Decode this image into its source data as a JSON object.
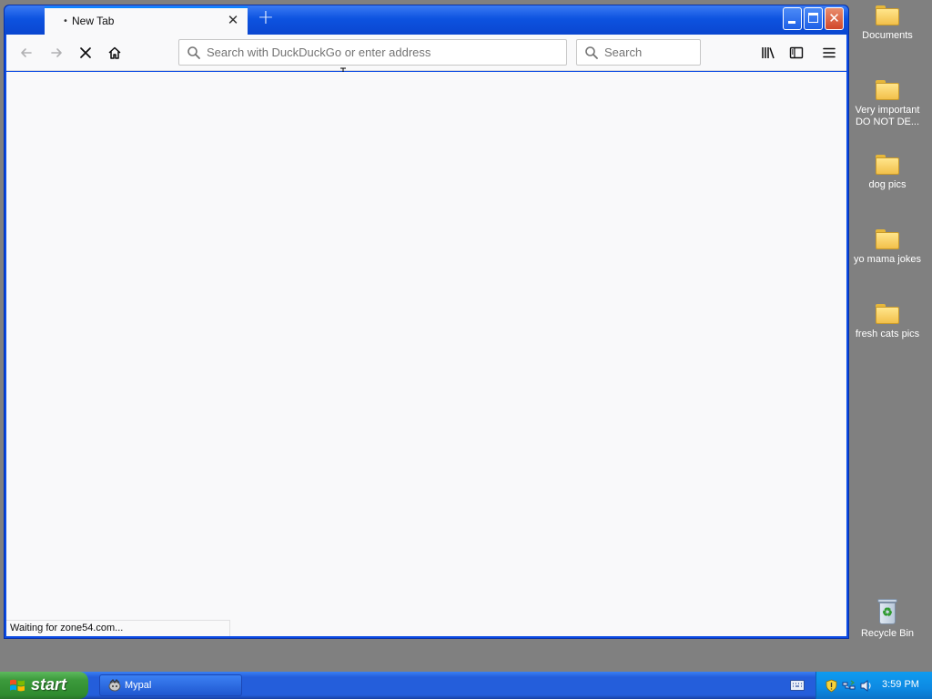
{
  "browser": {
    "tab": {
      "title": "New Tab",
      "loading_dot": "•",
      "close_glyph": "✕"
    },
    "new_tab_glyph": "+",
    "window_controls": {
      "close_glyph": "✕"
    },
    "urlbar": {
      "placeholder": "Search with DuckDuckGo or enter address",
      "value": ""
    },
    "searchbar": {
      "placeholder": "Search",
      "value": ""
    },
    "nav_icons": [
      "back-icon",
      "forward-icon",
      "stop-icon",
      "home-icon",
      "library-icon",
      "sidebar-icon",
      "menu-icon"
    ],
    "status_text": "Waiting for zone54.com..."
  },
  "desktop": {
    "icons": [
      {
        "label": "Documents",
        "icon": "folder-icon"
      },
      {
        "label": "Very important DO NOT DE...",
        "icon": "folder-icon"
      },
      {
        "label": "dog pics",
        "icon": "folder-icon"
      },
      {
        "label": "yo mama jokes",
        "icon": "folder-icon"
      },
      {
        "label": "fresh cats pics",
        "icon": "folder-icon"
      },
      {
        "label": "Recycle Bin",
        "icon": "recycle-bin-icon"
      }
    ]
  },
  "taskbar": {
    "start_label": "start",
    "tasks": [
      {
        "label": "Mypal",
        "icon": "mypal-icon"
      }
    ],
    "clock": "3:59 PM"
  },
  "colors": {
    "titlebar_blue": "#0d53e0",
    "taskbar_blue": "#245edb",
    "start_green": "#3c9a3c",
    "desktop_gray": "#808080",
    "content_bg": "#f9f9fa",
    "close_red": "#d2472a"
  }
}
